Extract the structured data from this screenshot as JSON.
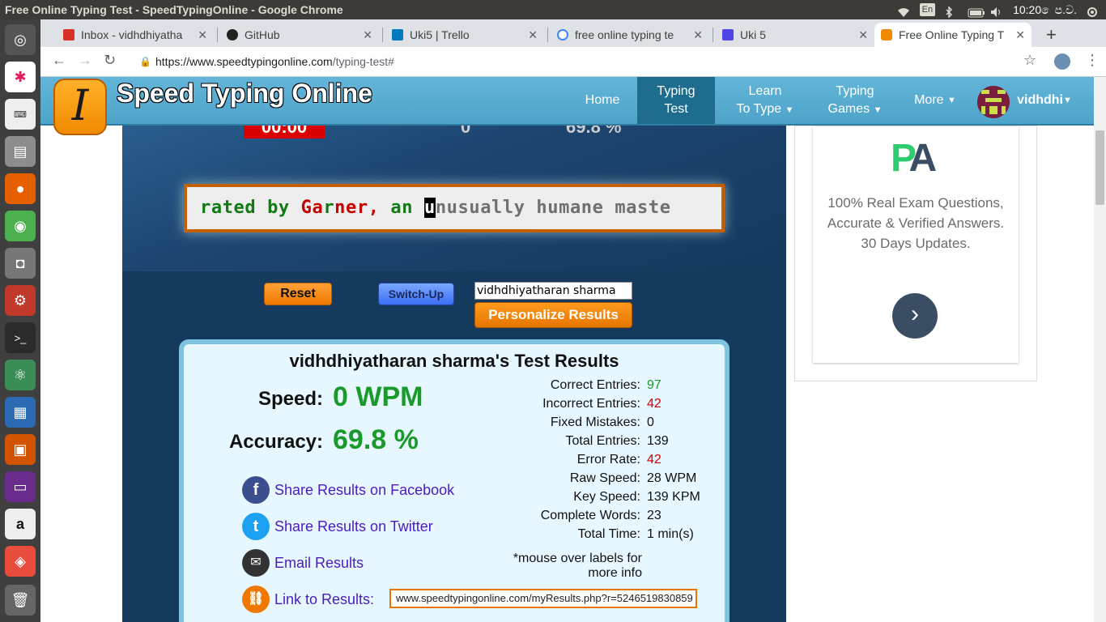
{
  "os": {
    "window_title": "Free Online Typing Test - SpeedTypingOnline - Google Chrome",
    "keyboard_layout": "En",
    "clock": "10:20 ෙප.ව."
  },
  "browser": {
    "tabs": [
      {
        "label": "Inbox - vidhdhiyathа",
        "icon": "gmail-icon",
        "color": "#d93025"
      },
      {
        "label": "GitHub",
        "icon": "github-icon",
        "color": "#222222"
      },
      {
        "label": "Uki5 | Trello",
        "icon": "trello-icon",
        "color": "#0079bf"
      },
      {
        "label": "free online typing te",
        "icon": "google-icon",
        "color": "#4285f4"
      },
      {
        "label": "Uki 5",
        "icon": "classroom-icon",
        "color": "#4f46e5"
      },
      {
        "label": "Free Online Typing T",
        "icon": "speedtyping-icon",
        "color": "#f08a00"
      }
    ],
    "url_host": "https://www.speedtypingonline.com",
    "url_path": "/typing-test#"
  },
  "site": {
    "logo_letter": "I",
    "logo_text": "Speed Typing Online",
    "nav": {
      "home": "Home",
      "typing_test_1": "Typing",
      "typing_test_2": "Test",
      "learn_1": "Learn",
      "learn_2": "To Type",
      "games_1": "Typing",
      "games_2": "Games",
      "more": "More",
      "user": "vidhdhi",
      "caret": "▼"
    }
  },
  "test": {
    "timer": "00:00",
    "wpm_top": "0",
    "accuracy_top": "69.8 %",
    "typed_green_1": "rated by ",
    "typed_red_1": "Ga",
    "typed_green_2": "r",
    "typed_red_2": "ner,",
    "typed_green_3": " an ",
    "cursor_char": "u",
    "untyped": "nusually humane maste",
    "reset_label": "Reset",
    "switch_label": "Switch-Up",
    "name_value": "vidhdhiyatharan sharma",
    "personalize_label": "Personalize Results"
  },
  "results": {
    "title": "vidhdhiyatharan sharma's Test Results",
    "speed_label": "Speed:",
    "speed_value": "0 WPM",
    "accuracy_label": "Accuracy:",
    "accuracy_value": "69.8 %",
    "stats": [
      {
        "label": "Correct Entries:",
        "value": "97",
        "tone": "green"
      },
      {
        "label": "Incorrect Entries:",
        "value": "42",
        "tone": "red"
      },
      {
        "label": "Fixed Mistakes:",
        "value": "0",
        "tone": ""
      },
      {
        "label": "Total Entries:",
        "value": "139",
        "tone": ""
      },
      {
        "label": "Error Rate:",
        "value": "42",
        "tone": "red"
      },
      {
        "label": "Raw Speed:",
        "value": "28 WPM",
        "tone": ""
      },
      {
        "label": "Key Speed:",
        "value": "139 KPM",
        "tone": ""
      },
      {
        "label": "Complete Words:",
        "value": "23",
        "tone": ""
      },
      {
        "label": "Total Time:",
        "value": "1 min(s)",
        "tone": ""
      }
    ],
    "note": "*mouse over labels for more info",
    "share_facebook": "Share Results on Facebook",
    "share_twitter": "Share Results on Twitter",
    "email": "Email Results",
    "link_label": "Link to Results:",
    "link_value": "www.speedtypingonline.com/myResults.php?r=5246519830859"
  },
  "ad": {
    "logo": "PA",
    "text": "100% Real Exam Questions, Accurate & Verified Answers. 30 Days Updates.",
    "arrow": "›"
  },
  "colors": {
    "header_blue": "#4ea3c9",
    "panel_navy": "#16395e",
    "accent_orange": "#f08a00",
    "correct_green": "#1a9a2a",
    "error_red": "#d00000"
  }
}
